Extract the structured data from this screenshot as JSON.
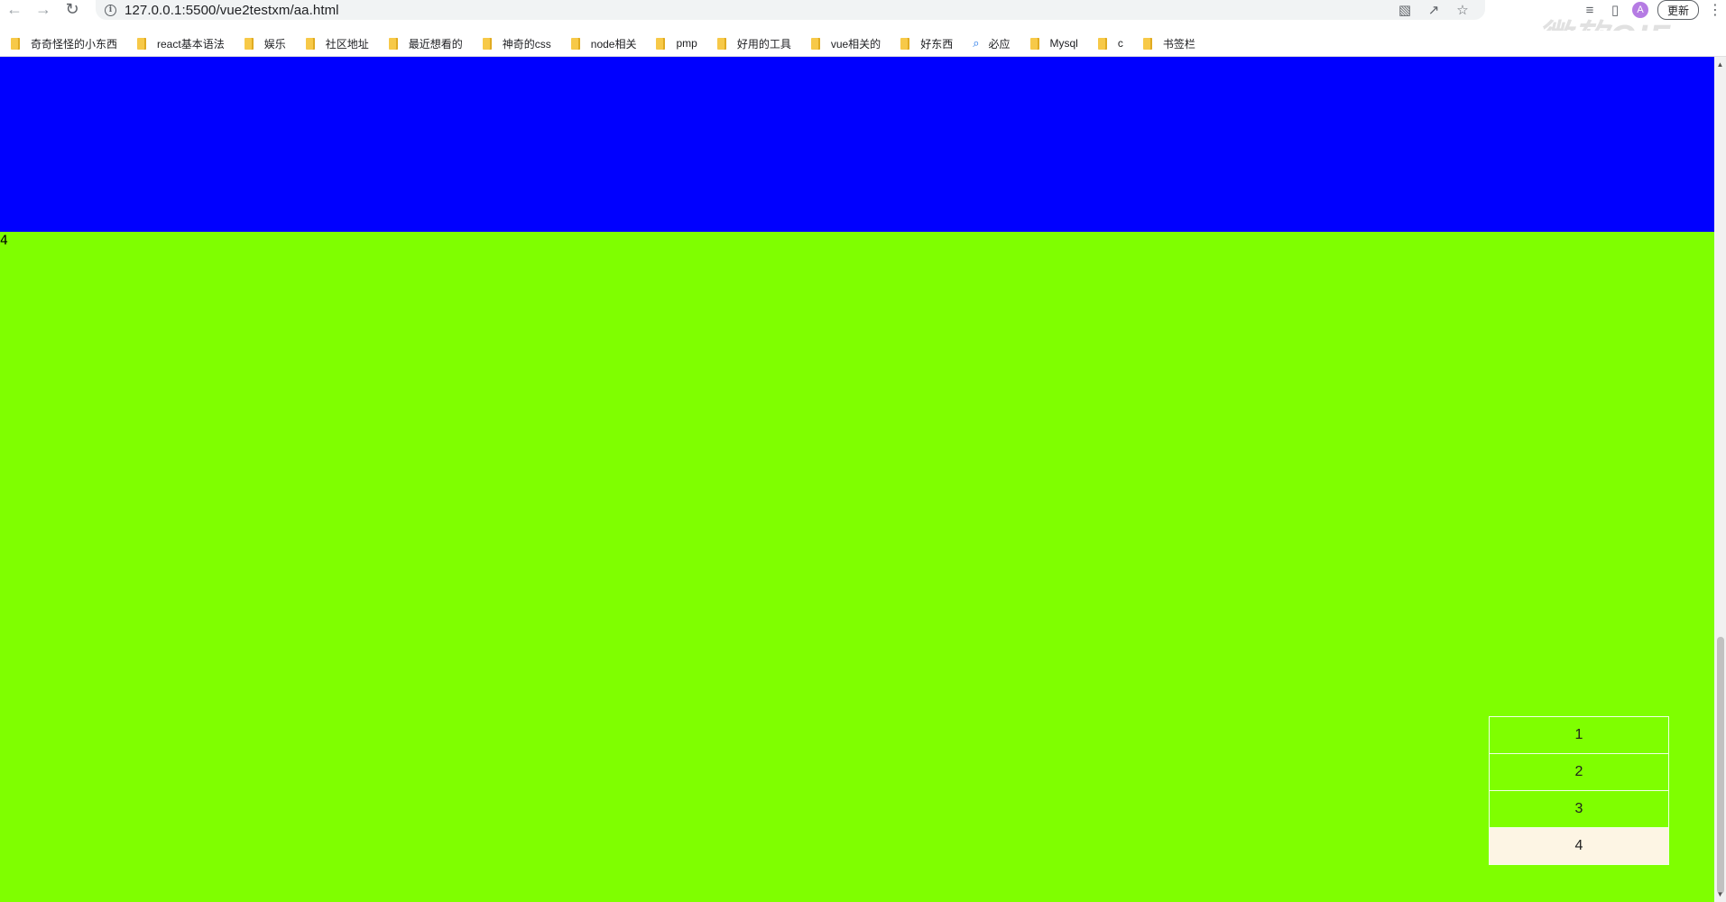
{
  "browser": {
    "url": "127.0.0.1:5500/vue2testxm/aa.html",
    "update_label": "更新",
    "avatar_initial": "A",
    "watermark": "微软GIF"
  },
  "bookmarks": [
    {
      "label": "奇奇怪怪的小东西",
      "icon": "folder-icon"
    },
    {
      "label": "react基本语法",
      "icon": "folder-icon"
    },
    {
      "label": "娱乐",
      "icon": "folder-icon"
    },
    {
      "label": "社区地址",
      "icon": "folder-icon"
    },
    {
      "label": "最近想看的",
      "icon": "folder-icon"
    },
    {
      "label": "神奇的css",
      "icon": "folder-icon"
    },
    {
      "label": "node相关",
      "icon": "folder-icon"
    },
    {
      "label": "pmp",
      "icon": "folder-icon"
    },
    {
      "label": "好用的工具",
      "icon": "folder-icon"
    },
    {
      "label": "vue相关的",
      "icon": "folder-icon"
    },
    {
      "label": "好东西",
      "icon": "folder-icon"
    },
    {
      "label": "必应",
      "icon": "search-icon"
    },
    {
      "label": "Mysql",
      "icon": "folder-icon"
    },
    {
      "label": "c",
      "icon": "folder-icon"
    },
    {
      "label": "书签栏",
      "icon": "folder-icon"
    }
  ],
  "page": {
    "sections": [
      {
        "label": "",
        "color": "#0000ff"
      },
      {
        "label": "4",
        "color": "#7fff00"
      }
    ],
    "nav": {
      "items": [
        "1",
        "2",
        "3",
        "4"
      ],
      "active_index": 3,
      "active_color": "#fdf5e4"
    }
  }
}
